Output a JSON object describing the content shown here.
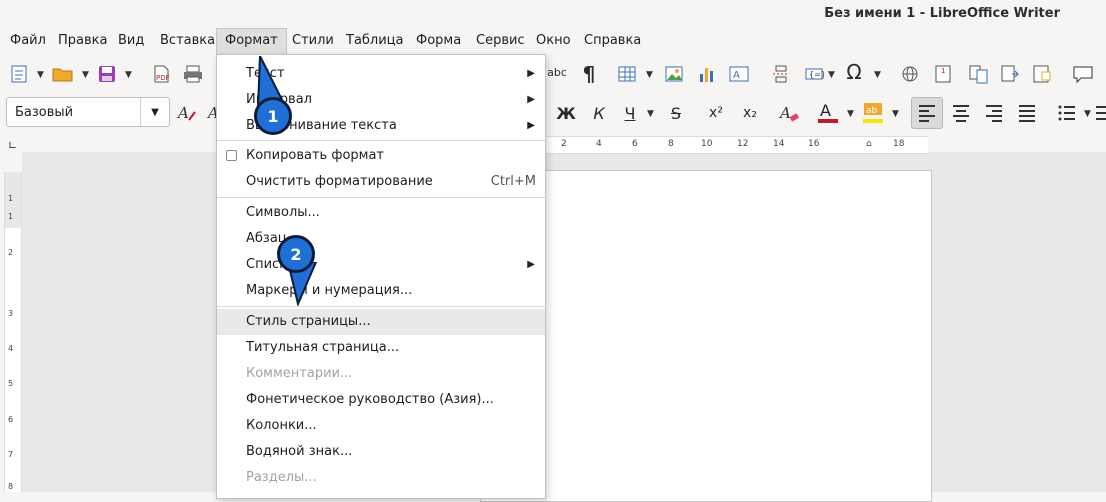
{
  "window": {
    "title": "Без имени 1 - LibreOffice Writer"
  },
  "menubar": {
    "items": [
      "Файл",
      "Правка",
      "Вид",
      "Вставка",
      "Формат",
      "Стили",
      "Таблица",
      "Форма",
      "Сервис",
      "Окно",
      "Справка"
    ],
    "active": "Формат"
  },
  "toolbar": {
    "paragraph_style": "Базовый",
    "bold_label": "Ж",
    "italic_label": "К",
    "underline_label": "Ч",
    "strike_label": "S",
    "superscript_label": "x²",
    "subscript_label": "x₂",
    "spell_label": "abc",
    "font_color": "#c01c28",
    "highlight_color": "#f5e50a"
  },
  "ruler": {
    "marks": [
      "2",
      "4",
      "6",
      "8",
      "10",
      "12",
      "14",
      "16",
      "18"
    ],
    "vertical_marks": [
      "1",
      "1",
      "2",
      "3",
      "4",
      "5",
      "6",
      "7",
      "8"
    ]
  },
  "format_menu": {
    "items": [
      {
        "label": "Текст",
        "submenu": true
      },
      {
        "label": "Интервал",
        "submenu": true
      },
      {
        "label": "Выравнивание текста",
        "submenu": true
      },
      {
        "label": "Копировать формат",
        "checkbox": true
      },
      {
        "label": "Очистить форматирование",
        "shortcut": "Ctrl+M"
      },
      {
        "label": "Символы..."
      },
      {
        "label": "Абзац..."
      },
      {
        "label": "Списки",
        "submenu": true
      },
      {
        "label": "Маркеры и нумерация..."
      },
      {
        "label": "Стиль страницы...",
        "highlighted": true
      },
      {
        "label": "Титульная страница..."
      },
      {
        "label": "Комментарии...",
        "disabled": true
      },
      {
        "label": "Фонетическое руководство (Азия)..."
      },
      {
        "label": "Колонки..."
      },
      {
        "label": "Водяной знак..."
      },
      {
        "label": "Разделы...",
        "disabled": true
      }
    ]
  },
  "annotations": {
    "marker1": "1",
    "marker2": "2"
  },
  "colors": {
    "marker_fill": "#1f6fd6",
    "marker_border": "#0d1b39"
  }
}
